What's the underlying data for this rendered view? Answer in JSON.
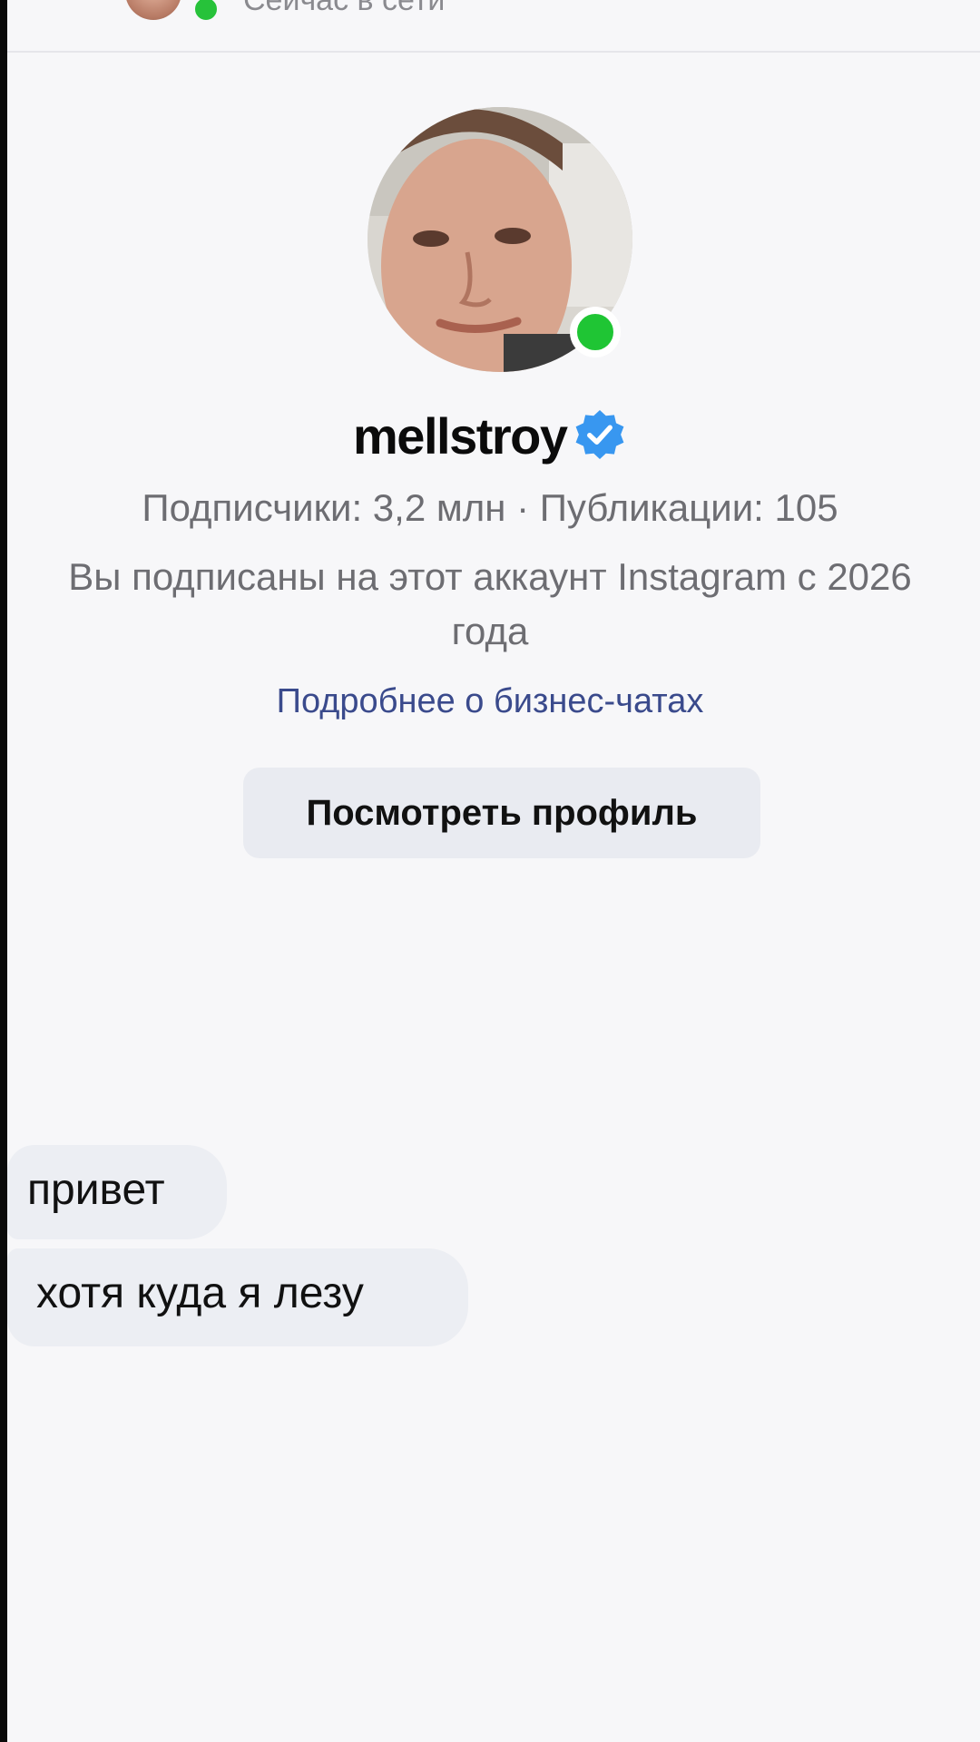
{
  "header": {
    "status": "Сейчас в сети"
  },
  "profile": {
    "username": "mellstroy",
    "verified": true,
    "stats": "Подписчики: 3,2 млн · Публикации: 105",
    "follow_info": "Вы подписаны на этот аккаунт Instagram с 2026 года",
    "business_link": "Подробнее о бизнес-чатах",
    "view_profile_label": "Посмотреть профиль"
  },
  "messages": [
    {
      "text": "привет"
    },
    {
      "text": "хотя куда я лезу"
    }
  ],
  "colors": {
    "online": "#1fc534",
    "verified_badge": "#3897f0",
    "link": "#3a4a8c",
    "bubble": "#eceef3",
    "secondary_text": "#6d6d72",
    "background": "#f7f7f9"
  }
}
